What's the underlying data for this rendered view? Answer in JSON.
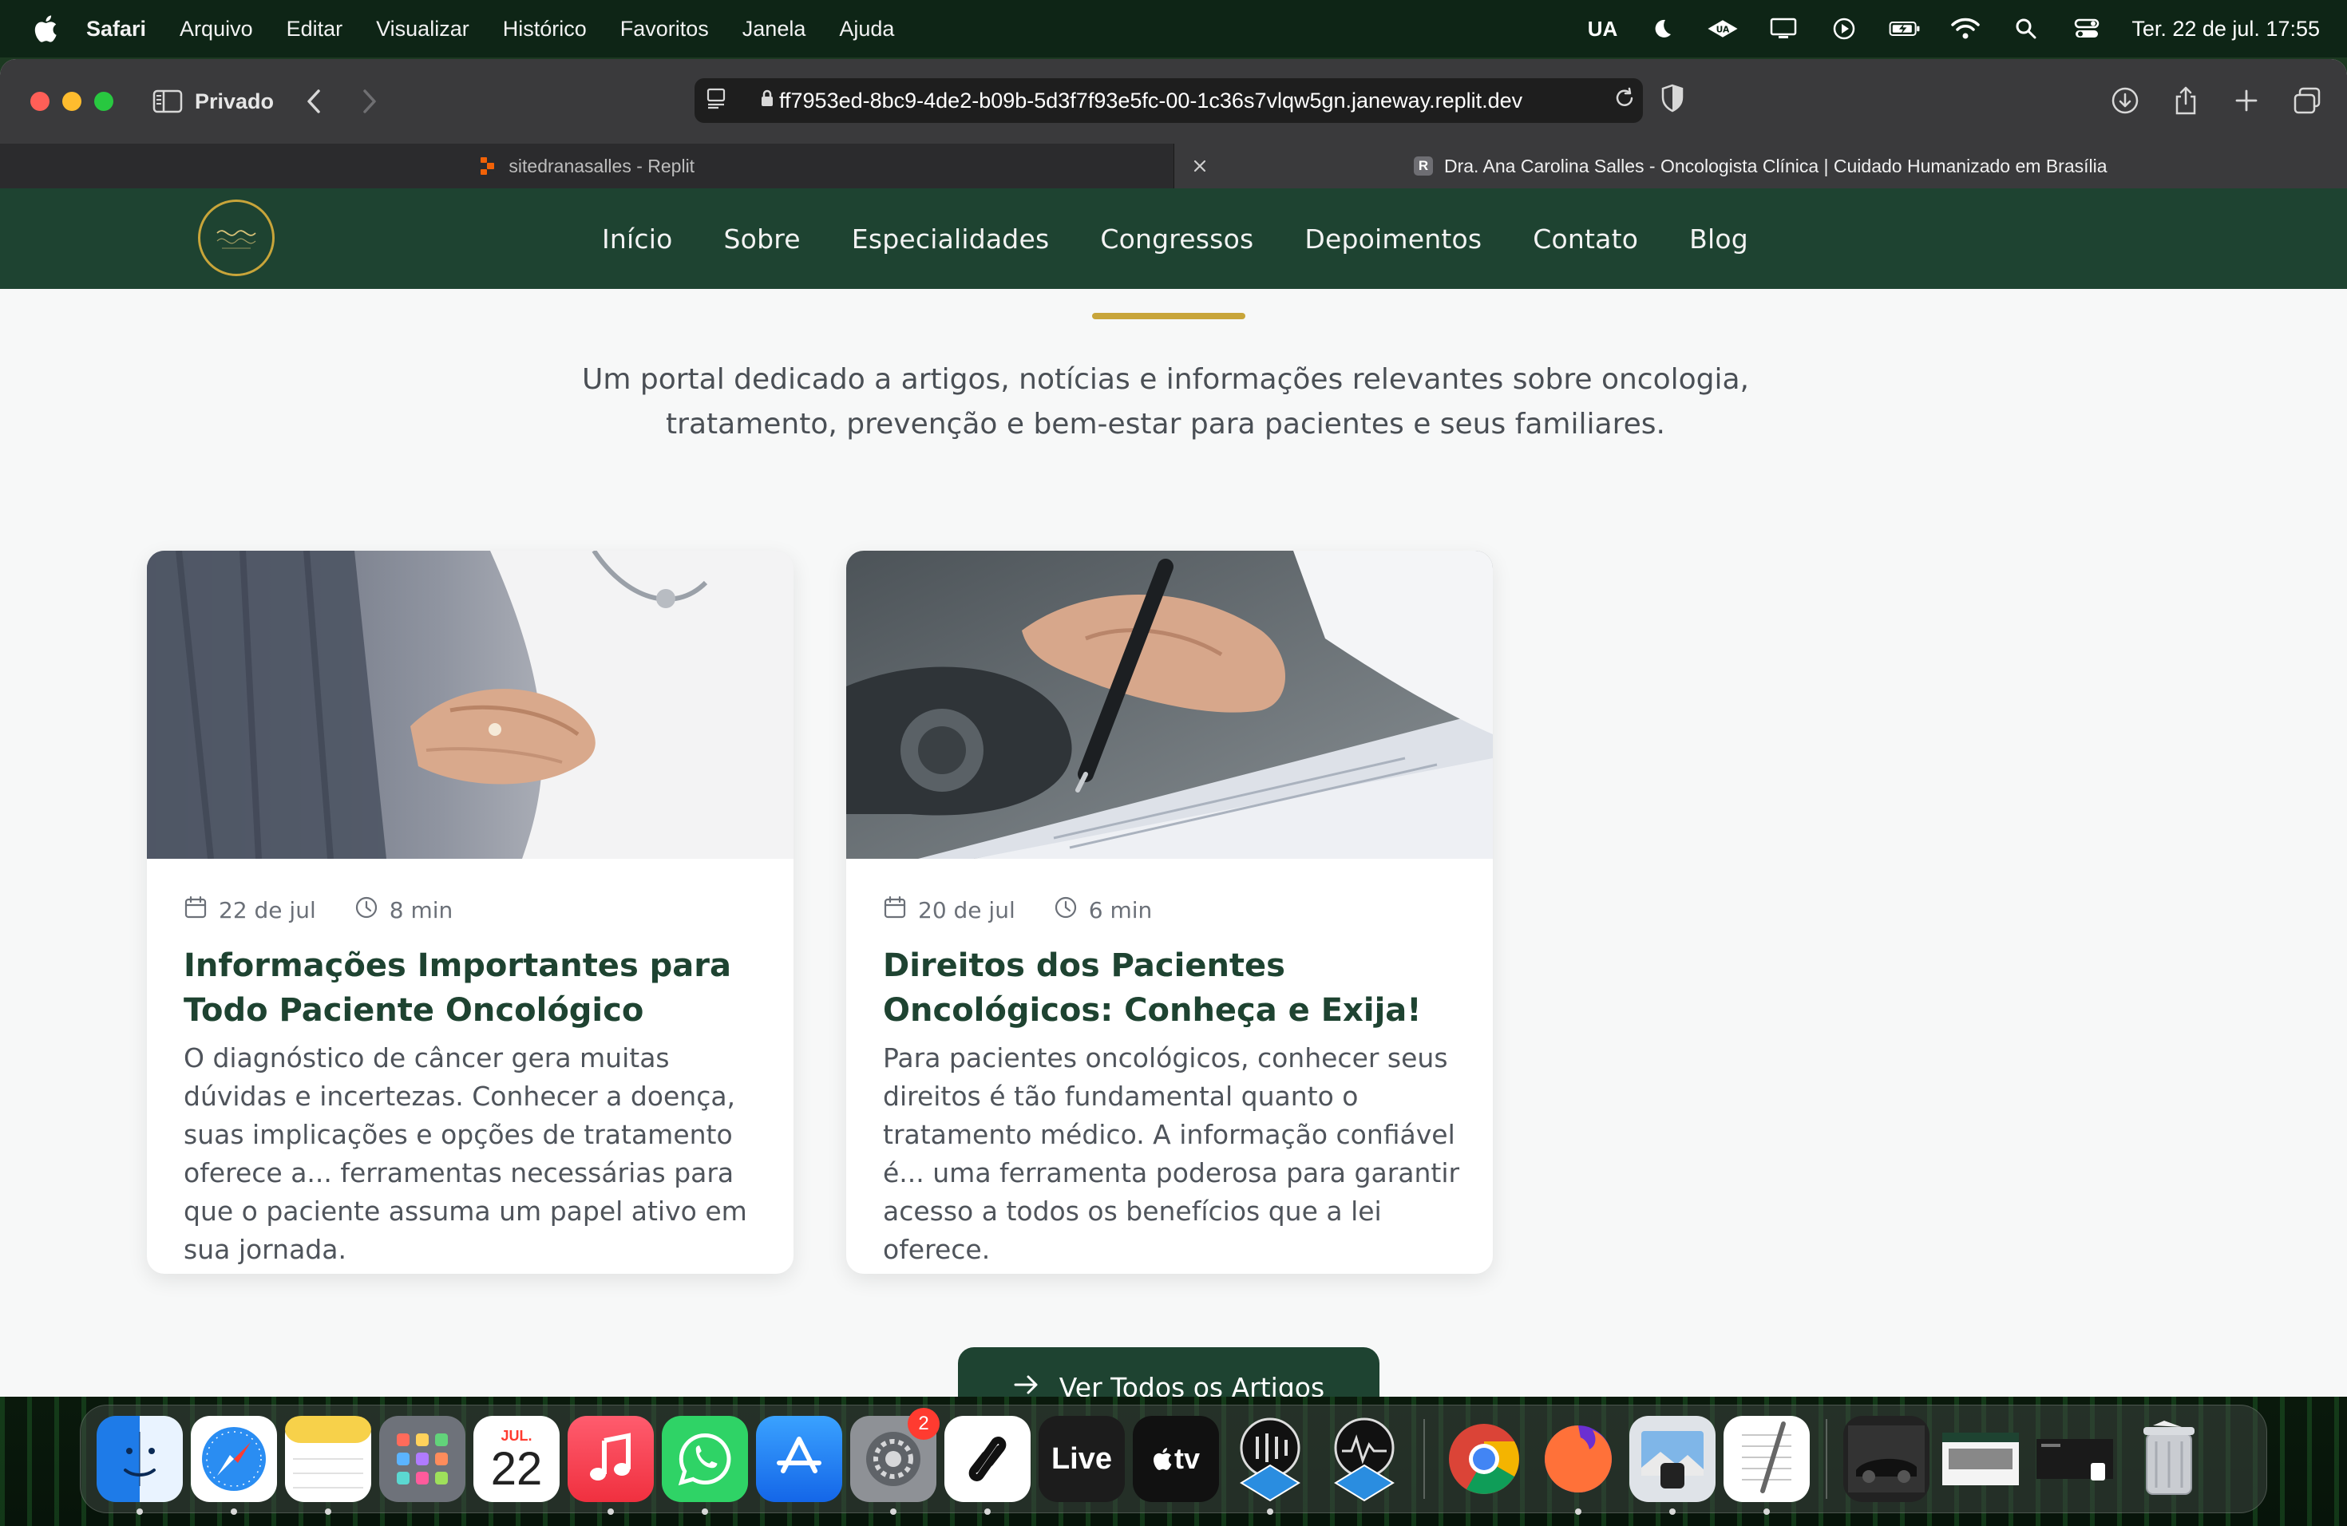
{
  "menubar": {
    "app": "Safari",
    "menus": [
      "Arquivo",
      "Editar",
      "Visualizar",
      "Histórico",
      "Favoritos",
      "Janela",
      "Ajuda"
    ],
    "status_ua": "UA",
    "clock": "Ter. 22 de jul.  17:55"
  },
  "browser": {
    "profile": "Privado",
    "url": "ff7953ed-8bc9-4de2-b09b-5d3f7f93e5fc-00-1c36s7vlqw5gn.janeway.replit.dev",
    "tabs": [
      {
        "title": "sitedranasalles - Replit",
        "active": false
      },
      {
        "title": "Dra. Ana Carolina Salles - Oncologista Clínica | Cuidado Humanizado em Brasília",
        "favicon": "R",
        "active": true
      }
    ]
  },
  "site": {
    "nav": [
      "Início",
      "Sobre",
      "Especialidades",
      "Congressos",
      "Depoimentos",
      "Contato",
      "Blog"
    ],
    "intro": "Um portal dedicado a artigos, notícias e informações relevantes sobre oncologia, tratamento, prevenção e bem-estar para pacientes e seus familiares.",
    "articles": [
      {
        "date": "22 de jul",
        "read_time": "8 min",
        "title": "Informações Importantes para Todo Paciente Oncológico",
        "excerpt": "O diagnóstico de câncer gera muitas dúvidas e incertezas. Conhecer a doença, suas implicações e opções de tratamento oferece a... ferramentas necessárias para que o paciente assuma um papel ativo em sua jornada."
      },
      {
        "date": "20 de jul",
        "read_time": "6 min",
        "title": "Direitos dos Pacientes Oncológicos: Conheça e Exija!",
        "excerpt": "Para pacientes oncológicos, conhecer seus direitos é tão fundamental quanto o tratamento médico. A informação confiável é... uma ferramenta poderosa para garantir acesso a todos os benefícios que a lei oferece."
      }
    ],
    "all_articles_label": "Ver Todos os Artigos"
  },
  "dock": {
    "calendar_month": "JUL.",
    "calendar_day": "22",
    "settings_badge": "2",
    "live_label": "Live",
    "tv_label": "tv"
  },
  "colors": {
    "brand_green": "#1e4331",
    "brand_gold": "#c8a53a",
    "whatsapp": "#45c15a"
  }
}
